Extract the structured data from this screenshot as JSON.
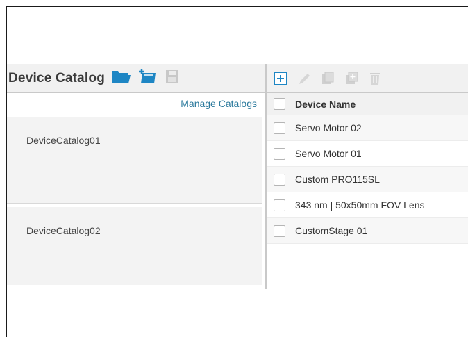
{
  "left": {
    "title": "Device Catalog",
    "icons": [
      "open-folder-icon",
      "add-catalog-icon",
      "save-icon"
    ],
    "manage_link": "Manage Catalogs",
    "catalogs": [
      {
        "name": "DeviceCatalog01"
      },
      {
        "name": "DeviceCatalog02"
      }
    ]
  },
  "right": {
    "toolbar_icons": [
      "add-icon",
      "edit-icon",
      "copy-icon",
      "duplicate-icon",
      "delete-icon"
    ],
    "column_header": "Device Name",
    "rows": [
      {
        "name": "Servo Motor 02"
      },
      {
        "name": "Servo Motor 01"
      },
      {
        "name": "Custom PRO115SL"
      },
      {
        "name": "343 nm | 50x50mm FOV Lens"
      },
      {
        "name": "CustomStage 01"
      }
    ]
  },
  "colors": {
    "accent": "#2c7a9d",
    "icon_blue": "#1e86c4",
    "disabled": "#c8c8c8"
  }
}
